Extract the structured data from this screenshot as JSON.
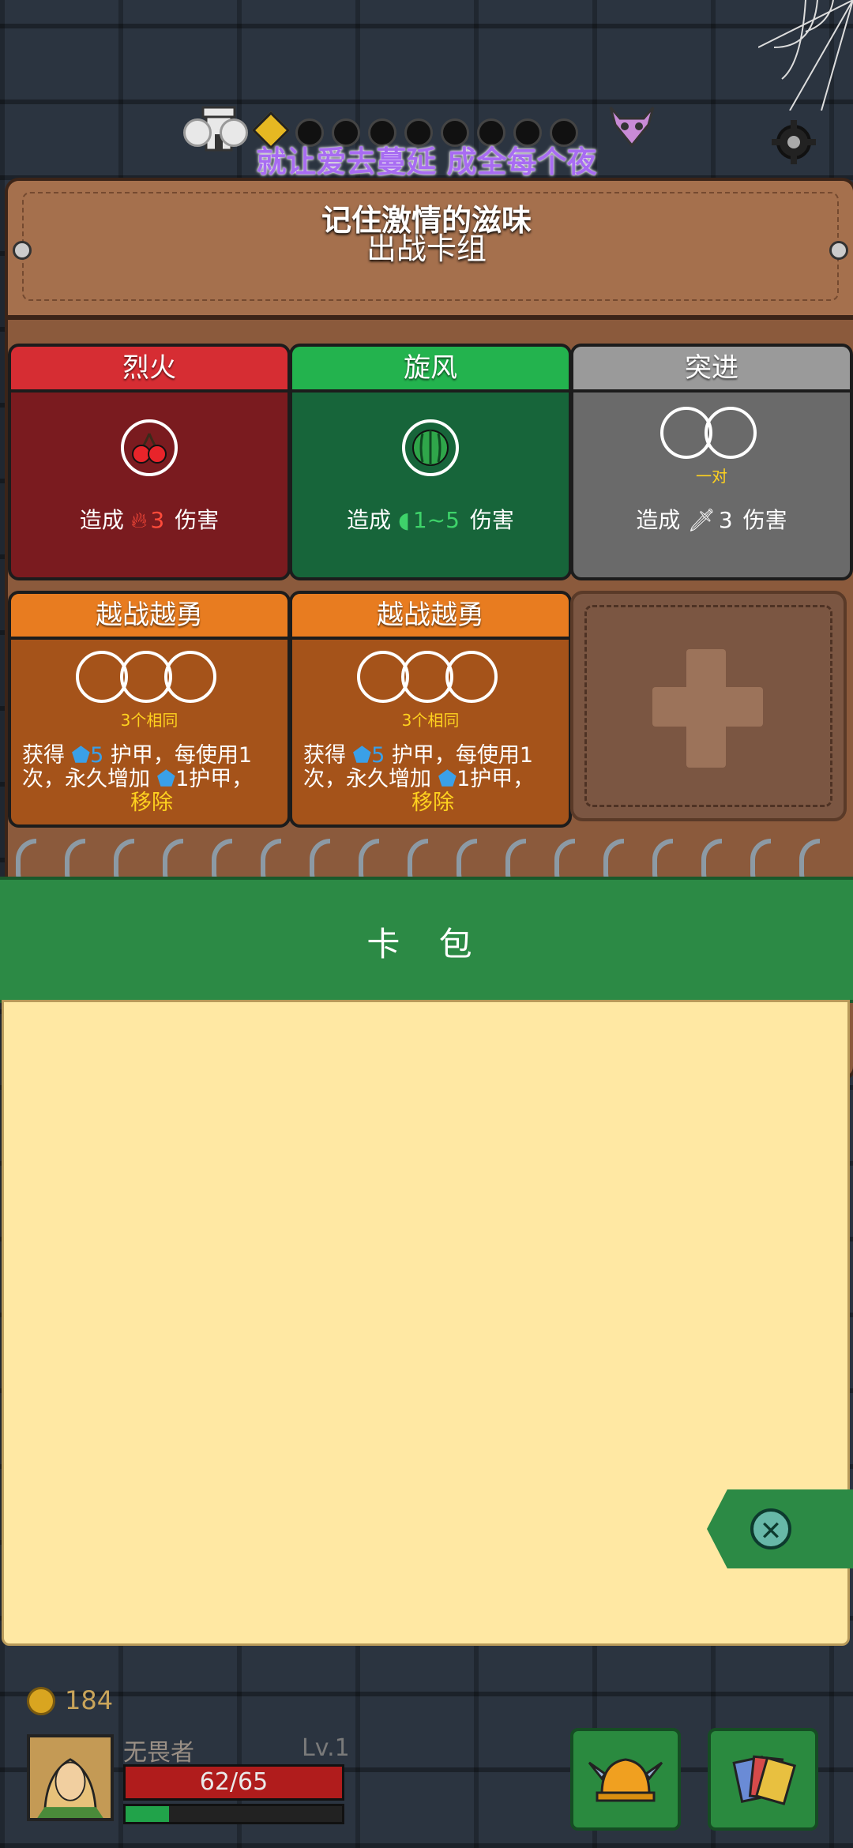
{
  "overlay": {
    "lyric_top": "就让爱去蔓延  成全每个夜",
    "lyric_bottom": "记住激情的滋味"
  },
  "deck": {
    "title": "出战卡组",
    "cards": [
      {
        "name": "烈火",
        "color": "#d62d33",
        "desc_prefix": "造成",
        "value": "3",
        "desc_suffix": "伤害",
        "value_color": "#ff4b3a",
        "icon": "cherries-icon"
      },
      {
        "name": "旋风",
        "color": "#23b34e",
        "desc_prefix": "造成",
        "value": "1~5",
        "desc_suffix": "伤害",
        "value_color": "#3ed36a",
        "icon": "watermelon-icon"
      },
      {
        "name": "突进",
        "color": "#9a9a9a",
        "slot_label": "一对",
        "desc_prefix": "造成",
        "value": "3",
        "desc_suffix": "伤害",
        "value_color": "#ffffff",
        "icon": "dagger-icon"
      },
      {
        "name": "越战越勇",
        "color": "#e87c20",
        "slot_label": "3个相同",
        "line1_prefix": "获得",
        "line1_value": "5",
        "line1_suffix": "护甲，每使用1",
        "line2_prefix": "次，永久增加",
        "line2_value": "1护甲，",
        "remove": "移除"
      },
      {
        "name": "越战越勇",
        "color": "#e87c20",
        "slot_label": "3个相同",
        "line1_prefix": "获得",
        "line1_value": "5",
        "line1_suffix": "护甲，每使用1",
        "line2_prefix": "次，永久增加",
        "line2_value": "1护甲，",
        "remove": "移除"
      }
    ]
  },
  "pack": {
    "label": "卡 包"
  },
  "player": {
    "gold": "184",
    "name": "无畏者",
    "level": "Lv.1",
    "hp": "62/65",
    "xp_fraction": 0.2
  },
  "colors": {
    "armor_blue": "#3aa0e8",
    "slot_yellow": "#ffd21f"
  }
}
